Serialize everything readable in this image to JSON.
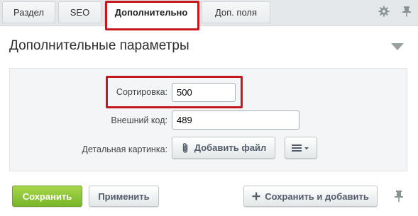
{
  "tabs": [
    {
      "label": "Раздел"
    },
    {
      "label": "SEO"
    },
    {
      "label": "Дополнительно"
    },
    {
      "label": "Доп. поля"
    }
  ],
  "tabbar_icons": [
    "gear-icon",
    "pin-icon"
  ],
  "section": {
    "title": "Дополнительные параметры",
    "collapse_icon": "triangle-down-icon"
  },
  "form": {
    "sort": {
      "label": "Сортировка:",
      "value": "500"
    },
    "external_code": {
      "label": "Внешний код:",
      "value": "489"
    },
    "detail_picture": {
      "label": "Детальная картинка:",
      "add_file_label": "Добавить файл",
      "add_file_icon": "paperclip-icon",
      "menu_icon": "hamburger-menu-icon"
    }
  },
  "footer": {
    "save_label": "Сохранить",
    "apply_label": "Применить",
    "save_add_label": "Сохранить и добавить",
    "save_add_icon": "plus-icon",
    "pin_icon": "pin-icon"
  },
  "colors": {
    "highlight": "#c4181d",
    "save_button": "#8cc63f",
    "panel_bg": "#f4f5f6",
    "tabbar_bg": "#e4e8ea"
  }
}
